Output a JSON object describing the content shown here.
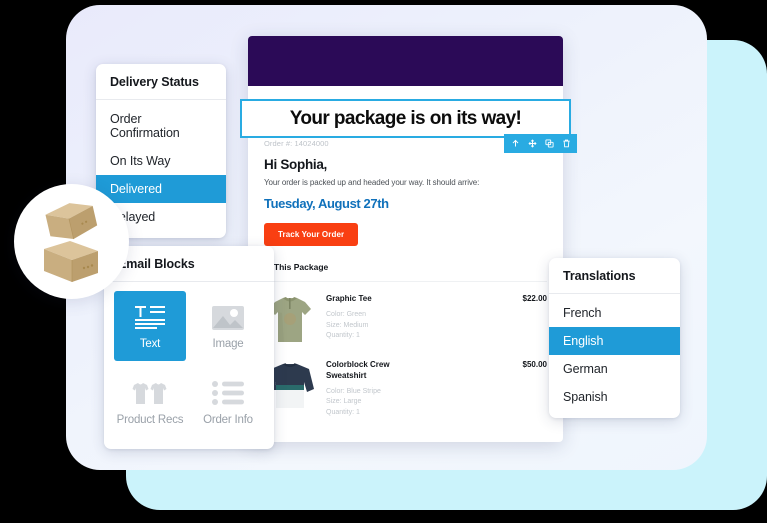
{
  "delivery_status": {
    "title": "Delivery Status",
    "items": [
      {
        "label": "Order Confirmation",
        "selected": false
      },
      {
        "label": "On Its Way",
        "selected": false
      },
      {
        "label": "Delivered",
        "selected": true
      },
      {
        "label": "Delayed",
        "selected": false
      }
    ]
  },
  "email_blocks": {
    "title": "Email Blocks",
    "tiles": [
      {
        "label": "Text",
        "icon": "text-block-icon",
        "active": true
      },
      {
        "label": "Image",
        "icon": "image-block-icon",
        "active": false
      },
      {
        "label": "Product Recs",
        "icon": "product-recs-icon",
        "active": false
      },
      {
        "label": "Order Info",
        "icon": "order-info-icon",
        "active": false
      }
    ]
  },
  "translations": {
    "title": "Translations",
    "items": [
      {
        "label": "French",
        "selected": false
      },
      {
        "label": "English",
        "selected": true
      },
      {
        "label": "German",
        "selected": false
      },
      {
        "label": "Spanish",
        "selected": false
      }
    ]
  },
  "email": {
    "headline": "Your package is on its way!",
    "order_number": "Order #: 14024000",
    "greeting": "Hi Sophia,",
    "subtext": "Your order is packed up and headed your way. It should arrive:",
    "arrival_date": "Tuesday, August 27th",
    "cta_label": "Track Your Order",
    "package_heading": "In This Package",
    "toolbar": [
      {
        "icon": "move-up-icon"
      },
      {
        "icon": "drag-move-icon"
      },
      {
        "icon": "duplicate-icon"
      },
      {
        "icon": "trash-icon"
      }
    ],
    "products": [
      {
        "name": "Graphic Tee",
        "price": "$22.00",
        "color": "Color: Green",
        "size": "Size: Medium",
        "quantity": "Quantity: 1",
        "thumb": "graphic-tee-thumbnail"
      },
      {
        "name": "Colorblock Crew Sweatshirt",
        "price": "$50.00",
        "color": "Color: Blue Stripe",
        "size": "Size: Large",
        "quantity": "Quantity: 1",
        "thumb": "colorblock-sweatshirt-thumbnail"
      }
    ]
  },
  "decor": {
    "package_illustration": "cardboard-boxes-illustration"
  },
  "colors": {
    "accent_blue": "#1F9BD7",
    "selection_blue": "#29ABE2",
    "cta_orange": "#F93F12",
    "banner_purple": "#2B0A57",
    "date_blue": "#1071BB",
    "cyan_panel": "#CBF3FB"
  }
}
